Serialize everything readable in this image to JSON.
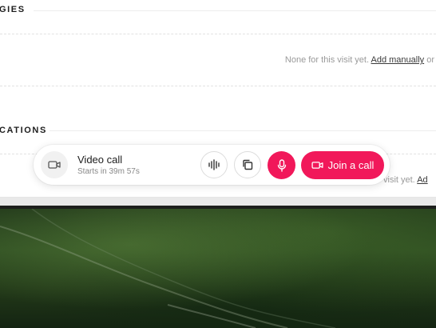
{
  "sections": {
    "allergies_title": "GIES",
    "allergies_empty": "None for this visit yet.",
    "allergies_add": "Add manually",
    "allergies_or": "or",
    "medications_title": "CATIONS",
    "medications_empty_tail": "visit yet.",
    "medications_add_tail": "Ad"
  },
  "callbar": {
    "title": "Video call",
    "subtitle": "Starts in 39m 57s",
    "join_label": "Join a call",
    "icons": [
      "video-camera-icon",
      "waveform-icon",
      "copy-icon",
      "microphone-icon",
      "video-camera-icon"
    ]
  },
  "colors": {
    "accent": "#f1185a",
    "muted_text": "#9a9a9a",
    "border": "#e2e2e2"
  }
}
